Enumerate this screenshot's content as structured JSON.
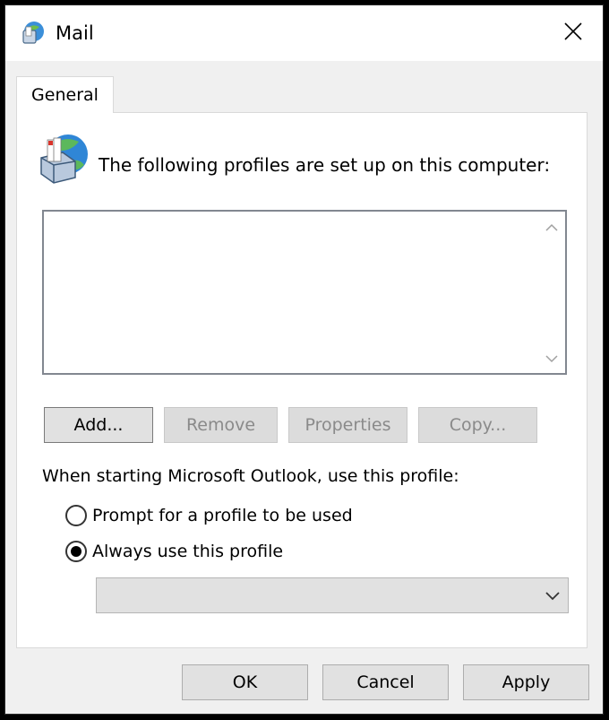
{
  "window": {
    "title": "Mail",
    "close_label": "✕"
  },
  "tabs": [
    {
      "label": "General"
    }
  ],
  "general": {
    "profiles_label": "The following profiles are set up on this computer:",
    "profiles": [],
    "buttons": {
      "add": "Add...",
      "remove": "Remove",
      "properties": "Properties",
      "copy": "Copy..."
    },
    "startup_label": "When starting Microsoft Outlook, use this profile:",
    "options": [
      {
        "label": "Prompt for a profile to be used",
        "selected": false
      },
      {
        "label": "Always use this profile",
        "selected": true
      }
    ],
    "profile_select_value": ""
  },
  "footer": {
    "ok": "OK",
    "cancel": "Cancel",
    "apply": "Apply"
  },
  "colors": {
    "panel_bg": "#f0f0f0",
    "button_bg": "#e1e1e1",
    "disabled_text": "#8a8a8a"
  }
}
